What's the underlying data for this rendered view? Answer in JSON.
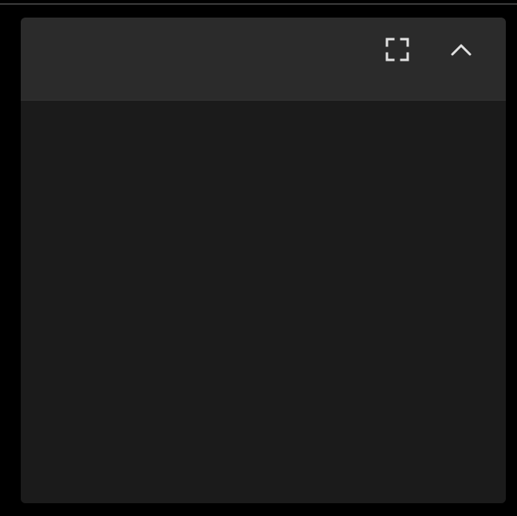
{
  "panel": {
    "header": {
      "buttons": [
        {
          "name": "fullscreen",
          "icon": "fullscreen-icon"
        },
        {
          "name": "collapse",
          "icon": "chevron-up-icon"
        }
      ]
    }
  },
  "colors": {
    "page_background": "#000000",
    "panel_header": "#2b2b2b",
    "panel_body": "#1b1b1b",
    "icon": "#e0e0e0"
  }
}
